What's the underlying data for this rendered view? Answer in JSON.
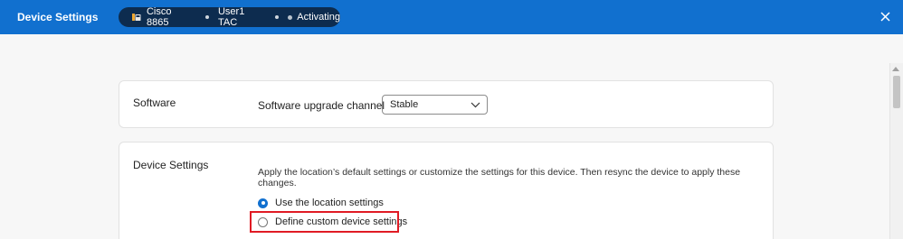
{
  "header": {
    "title": "Device Settings",
    "device_model": "Cisco 8865",
    "user": "User1 TAC",
    "status": "Activating"
  },
  "software": {
    "title": "Software",
    "upgrade_label": "Software upgrade channel",
    "upgrade_value": "Stable"
  },
  "device_settings": {
    "title": "Device Settings",
    "description": "Apply the location’s default settings or customize the settings for this device. Then resync the device to apply these changes.",
    "options": [
      {
        "label": "Use the location settings",
        "selected": true
      },
      {
        "label": "Define custom device settings",
        "selected": false
      }
    ]
  },
  "colors": {
    "header_bg": "#1170cf",
    "pill_bg": "#0d2c4f",
    "highlight": "#e01b24"
  }
}
